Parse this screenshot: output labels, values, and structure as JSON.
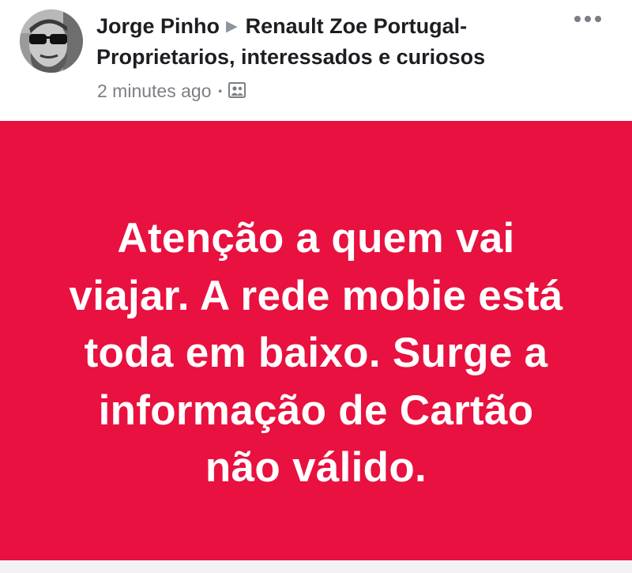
{
  "post": {
    "author": "Jorge Pinho",
    "group_line1": "Renault Zoe Portugal-",
    "group_line2": "Proprietarios, interessados e curiosos",
    "timestamp": "2 minutes ago",
    "dot": "·",
    "privacy_icon": "group-icon",
    "more_icon": "more-options-icon"
  },
  "banner": {
    "lines": [
      "Atenção a quem vai",
      "viajar. A rede mobie está",
      "toda em baixo. Surge a",
      "informação de Cartão",
      "não válido."
    ],
    "background": "#e8113f",
    "text_color": "#ffffff"
  }
}
